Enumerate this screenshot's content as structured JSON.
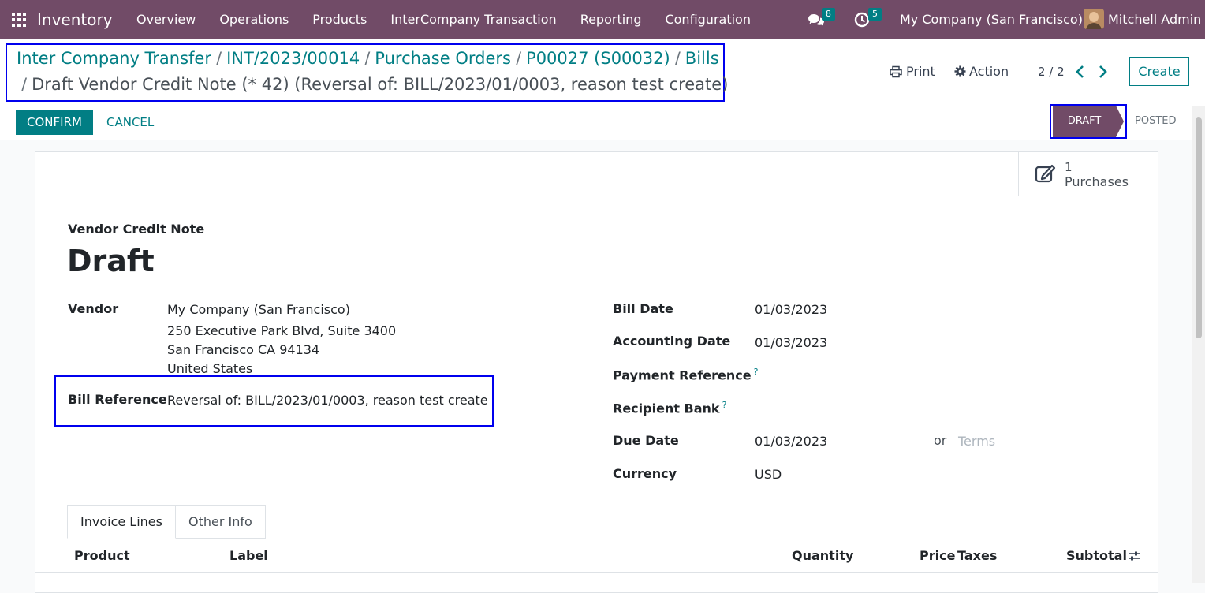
{
  "navbar": {
    "app_name": "Inventory",
    "menu": [
      {
        "label": "Overview"
      },
      {
        "label": "Operations"
      },
      {
        "label": "Products"
      },
      {
        "label": "InterCompany Transaction"
      },
      {
        "label": "Reporting"
      },
      {
        "label": "Configuration"
      }
    ],
    "messages_count": "8",
    "activities_count": "5",
    "company": "My Company (San Francisco)",
    "user": "Mitchell Admin"
  },
  "breadcrumb": {
    "items": [
      "Inter Company Transfer",
      "INT/2023/00014",
      "Purchase Orders",
      "P00027 (S00032)",
      "Bills"
    ],
    "separator": "/",
    "current": "Draft Vendor Credit Note (* 42) (Reversal of: BILL/2023/01/0003, reason test create)"
  },
  "toolbar": {
    "print_label": "Print",
    "action_label": "Action",
    "pager": "2 / 2",
    "create_label": "Create"
  },
  "statusbar": {
    "confirm_label": "CONFIRM",
    "cancel_label": "CANCEL",
    "stages": [
      "DRAFT",
      "POSTED"
    ],
    "active_stage": "DRAFT"
  },
  "smart_button": {
    "count": "1",
    "label": "Purchases"
  },
  "form": {
    "subtitle": "Vendor Credit Note",
    "title": "Draft",
    "vendor_label": "Vendor",
    "vendor_lines": [
      "My Company (San Francisco)",
      "250 Executive Park Blvd, Suite 3400",
      "San Francisco CA 94134",
      "United States"
    ],
    "bill_reference_label": "Bill Reference",
    "bill_reference": "Reversal of: BILL/2023/01/0003, reason test create",
    "bill_date_label": "Bill Date",
    "bill_date": "01/03/2023",
    "accounting_date_label": "Accounting Date",
    "accounting_date": "01/03/2023",
    "payment_reference_label": "Payment Reference",
    "recipient_bank_label": "Recipient Bank",
    "due_date_label": "Due Date",
    "due_date": "01/03/2023",
    "or_label": "or",
    "terms_placeholder": "Terms",
    "currency_label": "Currency",
    "currency": "USD",
    "help_mark": "?"
  },
  "tabs": [
    "Invoice Lines",
    "Other Info"
  ],
  "table": {
    "columns": [
      "Product",
      "Label",
      "Quantity",
      "Price",
      "Taxes",
      "Subtotal"
    ]
  },
  "colors": {
    "brand": "#714b67",
    "accent": "#017e84",
    "highlight": "#0000ee"
  }
}
